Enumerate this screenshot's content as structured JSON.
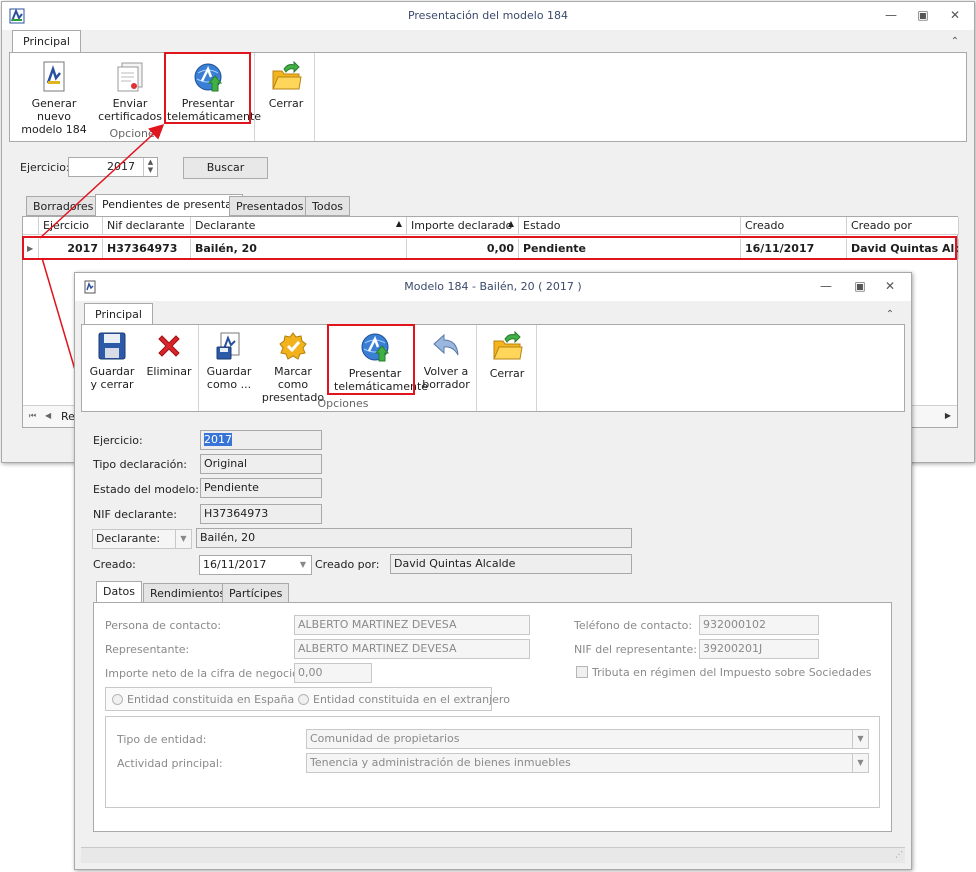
{
  "main_window": {
    "title": "Presentación del modelo 184",
    "ribbon_tab": "Principal",
    "buttons": {
      "generar": "Generar nuevo\nmodelo 184",
      "enviar": "Enviar\ncertificados",
      "presentar": "Presentar\ntelemáticamente",
      "cerrar": "Cerrar"
    },
    "group_label": "Opciones",
    "ejercicio_label": "Ejercicio:",
    "ejercicio_value": "2017",
    "buscar": "Buscar",
    "tabs": [
      "Borradores",
      "Pendientes de presentar",
      "Presentados",
      "Todos"
    ],
    "columns": [
      "Ejercicio",
      "Nif declarante",
      "Declarante",
      "Importe declarado",
      "Estado",
      "Creado",
      "Creado por"
    ],
    "row": {
      "ejercicio": "2017",
      "nif": "H37364973",
      "declarante": "Bailén, 20",
      "importe": "0,00",
      "estado": "Pendiente",
      "creado": "16/11/2017",
      "creado_por": "David Quintas Alcalde"
    },
    "nav_partial": "Re"
  },
  "modal": {
    "title": "Modelo 184 - Bailén, 20 ( 2017 )",
    "ribbon_tab": "Principal",
    "buttons": {
      "guardar_cerrar": "Guardar\ny cerrar",
      "eliminar": "Eliminar",
      "guardar_como": "Guardar\ncomo ...",
      "marcar": "Marcar como\npresentado",
      "presentar": "Presentar\ntelemáticamente",
      "volver": "Volver a\nborrador",
      "cerrar": "Cerrar"
    },
    "group_label": "Opciones",
    "form": {
      "ejercicio_label": "Ejercicio:",
      "ejercicio": "2017",
      "tipo_label": "Tipo declaración:",
      "tipo": "Original",
      "estado_label": "Estado del modelo:",
      "estado": "Pendiente",
      "nif_label": "NIF declarante:",
      "nif": "H37364973",
      "declarante_select": "Declarante:",
      "declarante": "Bailén, 20",
      "creado_label": "Creado:",
      "creado": "16/11/2017",
      "creado_por_label": "Creado por:",
      "creado_por": "David Quintas Alcalde"
    },
    "tabs": [
      "Datos",
      "Rendimientos",
      "Partícipes"
    ],
    "datos": {
      "persona_label": "Persona de contacto:",
      "persona": "ALBERTO MARTINEZ DEVESA",
      "representante_label": "Representante:",
      "representante": "ALBERTO MARTINEZ DEVESA",
      "importe_label": "Importe neto de la cifra de negocios:",
      "importe": "0,00",
      "telefono_label": "Teléfono de contacto:",
      "telefono": "932000102",
      "nif_rep_label": "NIF del representante:",
      "nif_rep": "39200201J",
      "tributa": "Tributa en régimen del Impuesto sobre Sociedades",
      "radio_espana": "Entidad constituida en España",
      "radio_extranjero": "Entidad constituida en el extranjero",
      "tipo_entidad_label": "Tipo de entidad:",
      "tipo_entidad": "Comunidad de propietarios",
      "actividad_label": "Actividad principal:",
      "actividad": "Tenencia y administración de bienes inmuebles"
    }
  },
  "colors": {
    "highlight": "#e0141d",
    "title_text": "#3b4a6b",
    "selection": "#3875d7"
  }
}
